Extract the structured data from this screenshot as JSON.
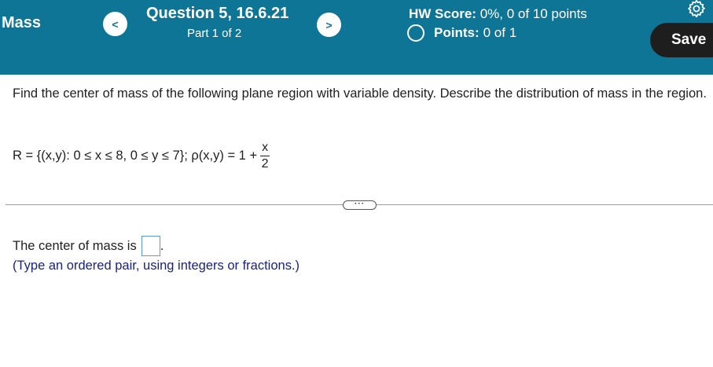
{
  "header": {
    "title": "Mass",
    "prev_icon": "chevron-left-icon",
    "next_icon": "chevron-right-icon",
    "prev_glyph": "<",
    "next_glyph": ">",
    "question_title": "Question 5, 16.6.21",
    "part": "Part 1 of 2",
    "hw_score_label": "HW Score:",
    "hw_score_value": "0%, 0 of 10 points",
    "points_label": "Points:",
    "points_value": "0 of 1",
    "settings_icon": "gear-icon",
    "save_label": "Save",
    "bg_color": "#0e7596"
  },
  "question": {
    "prompt": "Find the center of mass of the following plane region with variable density. Describe the distribution of mass in the region.",
    "formula_text": "R = {(x,y): 0 ≤ x ≤ 8, 0 ≤ y ≤ 7}; ρ(x,y) = 1 +",
    "fraction_numerator": "x",
    "fraction_denominator": "2"
  },
  "expand_button": {
    "label": "···"
  },
  "answer": {
    "prefix": "The center of mass is",
    "value": "",
    "suffix": ".",
    "hint": "(Type an ordered pair, using integers or fractions.)"
  }
}
